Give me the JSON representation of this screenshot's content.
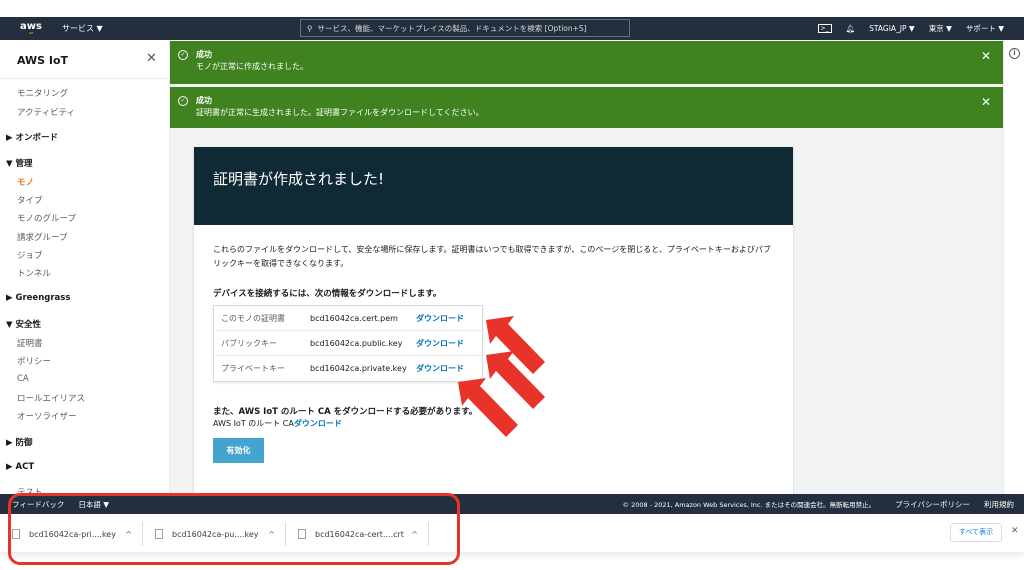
{
  "nav": {
    "logo": "aws",
    "services": "サービス ▼",
    "search_placeholder": "サービス、機能、マーケットプレイスの製品、ドキュメントを検索 [Option+S]",
    "user": "STAGIA_JP ▼",
    "region": "東京 ▼",
    "support": "サポート ▼"
  },
  "sidebar": {
    "title": "AWS IoT",
    "close": "✕",
    "items": [
      {
        "label": "モニタリング"
      },
      {
        "label": "アクティビティ"
      }
    ],
    "onboard": "▶ オンボード",
    "manage": "▼ 管理",
    "manage_items": [
      "モノ",
      "タイプ",
      "モノのグループ",
      "請求グループ",
      "ジョブ",
      "トンネル"
    ],
    "greengrass": "▶ Greengrass",
    "security": "▼ 安全性",
    "security_items": [
      "証明書",
      "ポリシー",
      "CA",
      "ロールエイリアス",
      "オーソライザー"
    ],
    "defend": "▶ 防御",
    "act": "▶ ACT",
    "test": "テスト"
  },
  "flash": [
    {
      "title": "成功",
      "message": "モノが正常に作成されました。"
    },
    {
      "title": "成功",
      "message": "証明書が正常に生成されました。証明書ファイルをダウンロードしてください。"
    }
  ],
  "card": {
    "title": "証明書が作成されました!",
    "description": "これらのファイルをダウンロードして、安全な場所に保存します。証明書はいつでも取得できますが、このページを閉じると、プライベートキーおよびパブリックキーを取得できなくなります。",
    "download_heading": "デバイスを接続するには、次の情報をダウンロードします。",
    "rows": [
      {
        "label": "このモノの証明書",
        "file": "bcd16042ca.cert.pem",
        "action": "ダウンロード"
      },
      {
        "label": "パブリックキー",
        "file": "bcd16042ca.public.key",
        "action": "ダウンロード"
      },
      {
        "label": "プライベートキー",
        "file": "bcd16042ca.private.key",
        "action": "ダウンロード"
      }
    ],
    "root_heading": "また、AWS IoT のルート CA をダウンロードする必要があります。",
    "root_label": "AWS IoT のルート CA",
    "root_link": "ダウンロード",
    "activate": "有効化"
  },
  "footer": {
    "feedback": "フィードバック",
    "language": "日本語 ▼",
    "copyright": "© 2008 - 2021, Amazon Web Services, Inc. またはその関連会社。無断転用禁止。",
    "privacy": "プライバシーポリシー",
    "terms": "利用規約"
  },
  "downloads": {
    "items": [
      "bcd16042ca-pri....key",
      "bcd16042ca-pu....key",
      "bcd16042ca-cert....crt"
    ],
    "show_all": "すべて表示",
    "close": "✕"
  },
  "colors": {
    "success": "#3f821f",
    "nav": "#232f3e",
    "link": "#0073bb",
    "annotation": "#e8332a"
  }
}
